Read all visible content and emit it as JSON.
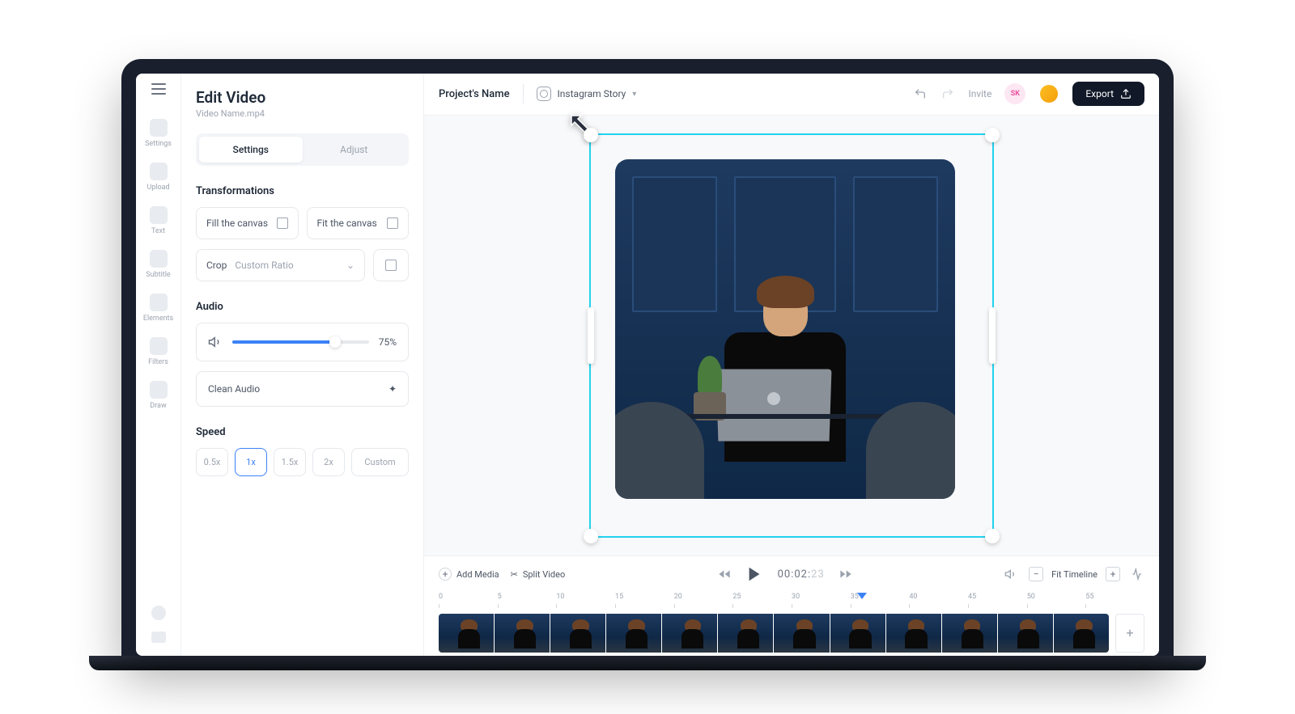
{
  "panel": {
    "title": "Edit Video",
    "subtitle": "Video Name.mp4",
    "tabs": {
      "settings": "Settings",
      "adjust": "Adjust"
    },
    "transformations": {
      "title": "Transformations",
      "fill": "Fill the canvas",
      "fit": "Fit the canvas",
      "crop_label": "Crop",
      "crop_value": "Custom Ratio"
    },
    "audio": {
      "title": "Audio",
      "volume": "75%",
      "clean": "Clean Audio"
    },
    "speed": {
      "title": "Speed",
      "options": [
        "0.5x",
        "1x",
        "1.5x",
        "2x",
        "Custom"
      ],
      "selected": "1x"
    }
  },
  "rail": {
    "items": [
      {
        "label": "Settings"
      },
      {
        "label": "Upload"
      },
      {
        "label": "Text"
      },
      {
        "label": "Subtitle"
      },
      {
        "label": "Elements"
      },
      {
        "label": "Filters"
      },
      {
        "label": "Draw"
      }
    ]
  },
  "topbar": {
    "project": "Project's Name",
    "platform": "Instagram Story",
    "invite": "Invite",
    "avatar_initials": "SK",
    "export": "Export"
  },
  "timeline": {
    "add_media": "Add Media",
    "split": "Split Video",
    "time_main": "00:02:",
    "time_sec": "23",
    "fit": "Fit Timeline",
    "ticks": [
      "0",
      "5",
      "10",
      "15",
      "20",
      "25",
      "30",
      "35",
      "40",
      "45",
      "50",
      "55"
    ]
  },
  "colors": {
    "accent": "#3b82f6",
    "selection": "#22d3ee",
    "dark": "#111827"
  }
}
